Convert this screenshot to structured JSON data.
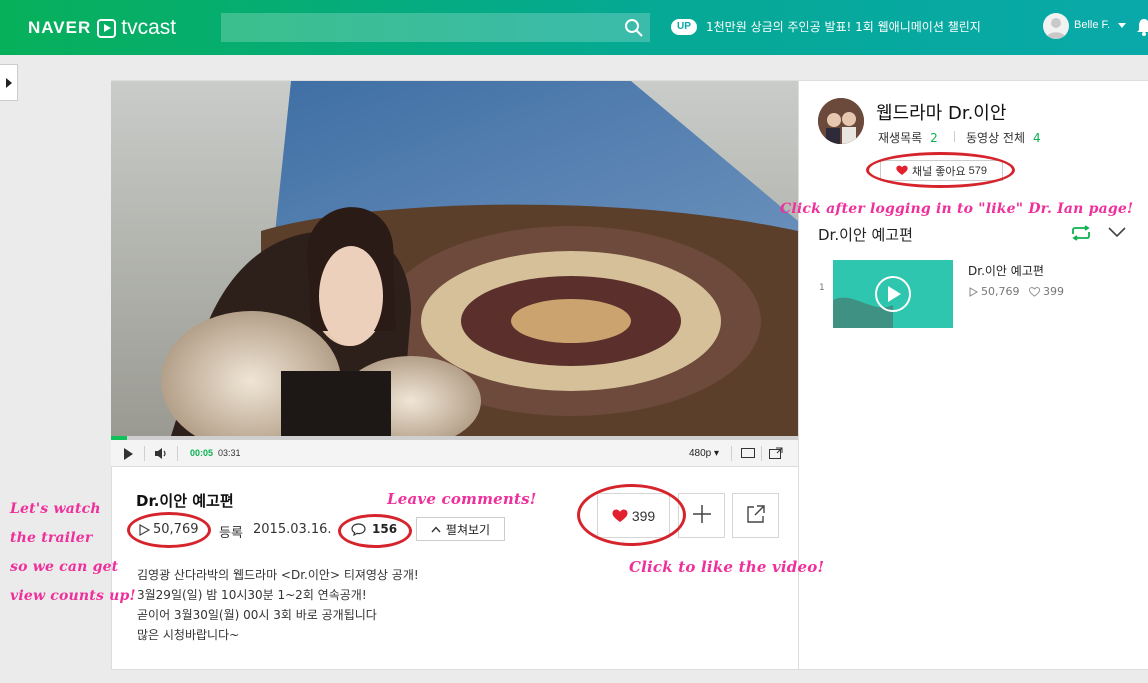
{
  "header": {
    "logo_naver": "NAVER",
    "logo_tvcast": "tvcast",
    "search_placeholder": "",
    "up_badge": "UP",
    "notice": "1천만원 상금의 주인공 발표! 1회 웹애니메이션 챌린지",
    "user_name": "Belle F."
  },
  "player": {
    "current_time": "00:05",
    "total_time": "03:31",
    "quality": "480p",
    "progress_fraction": 0.024
  },
  "video": {
    "title": "Dr.이안 예고편",
    "views": "50,769",
    "registered_label": "등록",
    "registered_date": "2015.03.16.",
    "comments": "156",
    "expand_label": "펼쳐보기",
    "likes": "399",
    "description": [
      "김영광 산다라박의 웹드라마 <Dr.이안> 티져영상 공개!",
      "3월29일(일) 밤 10시30분 1~2회 연속공개!",
      "곧이어 3월30일(월) 00시 3회 바로 공개됩니다",
      "많은 시청바랍니다~"
    ]
  },
  "channel": {
    "name": "웹드라마 Dr.이안",
    "playlist_label": "재생목록",
    "playlist_count": "2",
    "all_videos_label": "동영상 전체",
    "all_videos_count": "4",
    "like_label": "채널 좋아요",
    "like_count": "579"
  },
  "playlist": {
    "title": "Dr.이안 예고편",
    "items": [
      {
        "index": "1",
        "title": "Dr.이안 예고편",
        "views": "50,769",
        "likes": "399"
      }
    ]
  },
  "annotations": {
    "like_channel": "Click after logging in to \"like\" Dr. Ian page!",
    "leave_comments": "Leave comments!",
    "like_video": "Click to like the video!",
    "watch_trailer": [
      "Let's watch",
      "the trailer",
      "so we can get",
      "view counts up!"
    ]
  },
  "colors": {
    "header_start": "#06b05a",
    "header_end": "#08a9a9",
    "accent_green": "#0bb24f",
    "heart_red": "#e2202e",
    "annotation_pink": "#ef2f9b",
    "circle_red": "#d6242c"
  }
}
